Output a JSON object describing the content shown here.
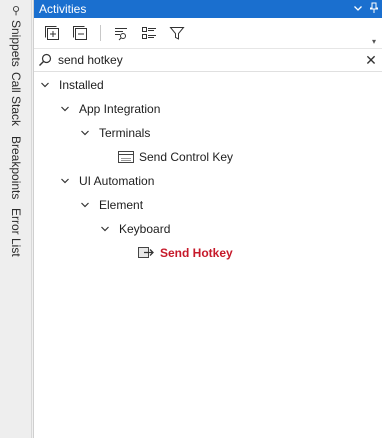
{
  "rail": {
    "tabs": [
      {
        "label": "Snippets",
        "icon": "pin-icon"
      },
      {
        "label": "Call Stack"
      },
      {
        "label": "Breakpoints"
      },
      {
        "label": "Error List"
      }
    ]
  },
  "panel": {
    "title": "Activities",
    "title_icons": [
      "chevron-down-icon",
      "pin-icon"
    ],
    "toolbar_icons": [
      "expand-all-icon",
      "collapse-all-icon",
      "filter-list-icon",
      "view-options-icon",
      "filter-icon"
    ],
    "accent": "#1a6fcf"
  },
  "search": {
    "value": "send hotkey"
  },
  "tree": {
    "installed": "Installed",
    "app_integration": "App Integration",
    "terminals": "Terminals",
    "send_control_key": "Send Control Key",
    "ui_automation": "UI Automation",
    "element": "Element",
    "keyboard": "Keyboard",
    "send_hotkey": "Send Hotkey",
    "highlight_color": "#c6192a"
  }
}
